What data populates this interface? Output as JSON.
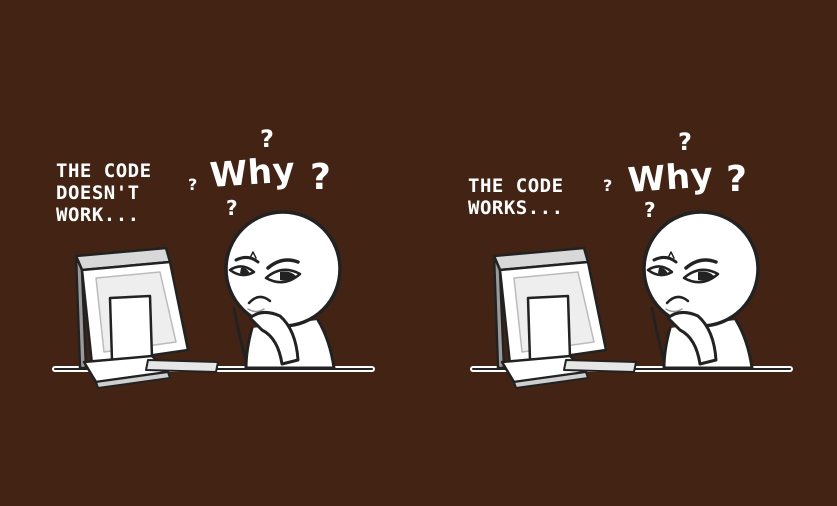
{
  "background_color": "#432414",
  "panels": [
    {
      "caption_lines": [
        "THE CODE",
        "DOESN'T",
        "WORK..."
      ],
      "reaction": "Why",
      "marks": [
        "?",
        "?",
        "?",
        "?"
      ]
    },
    {
      "caption_lines": [
        "THE CODE",
        "WORKS..."
      ],
      "reaction": "Why",
      "marks": [
        "?",
        "?",
        "?",
        "?"
      ]
    }
  ]
}
